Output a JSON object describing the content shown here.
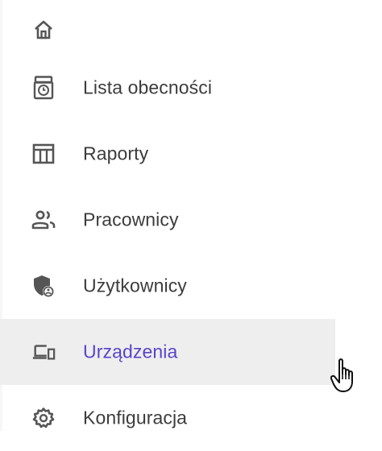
{
  "sidebar": {
    "items": [
      {
        "label": "",
        "icon": "home-icon"
      },
      {
        "label": "Lista obecności",
        "icon": "time-clock-icon"
      },
      {
        "label": "Raporty",
        "icon": "table-report-icon"
      },
      {
        "label": "Pracownicy",
        "icon": "people-icon"
      },
      {
        "label": "Użytkownicy",
        "icon": "user-shield-icon"
      },
      {
        "label": "Urządzenia",
        "icon": "devices-icon",
        "active": true
      },
      {
        "label": "Konfiguracja",
        "icon": "gear-icon"
      }
    ]
  },
  "colors": {
    "icon": "#555555",
    "text": "#3c3c3c",
    "active_text": "#5b43c9",
    "active_background": "#eeeeee"
  }
}
